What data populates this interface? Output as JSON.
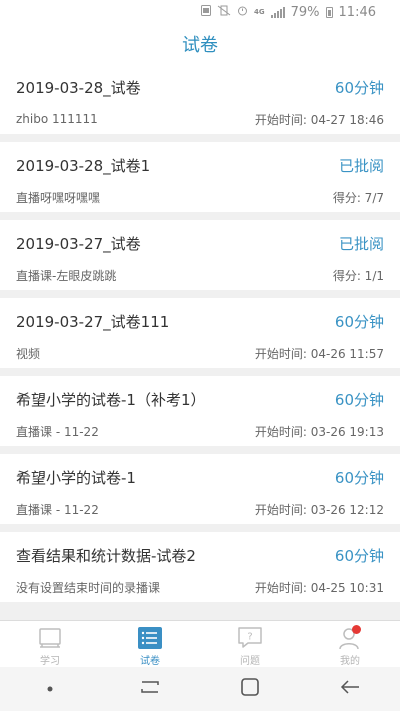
{
  "status_bar": {
    "network": "4G",
    "battery": "79%",
    "time": "11:46"
  },
  "header": {
    "title": "试卷"
  },
  "exams": [
    {
      "name": "2019-03-28_试卷",
      "status": "60分钟",
      "subtitle": "zhibo 111111",
      "meta": "开始时间: 04-27 18:46"
    },
    {
      "name": "2019-03-28_试卷1",
      "status": "已批阅",
      "subtitle": "直播呀嘿呀嘿嘿",
      "meta": "得分: 7/7"
    },
    {
      "name": "2019-03-27_试卷",
      "status": "已批阅",
      "subtitle": "直播课-左眼皮跳跳",
      "meta": "得分: 1/1"
    },
    {
      "name": "2019-03-27_试卷111",
      "status": "60分钟",
      "subtitle": "视频",
      "meta": "开始时间: 04-26 11:57"
    },
    {
      "name": "希望小学的试卷-1（补考1）",
      "status": "60分钟",
      "subtitle": "直播课 - 11-22",
      "meta": "开始时间: 03-26 19:13"
    },
    {
      "name": "希望小学的试卷-1",
      "status": "60分钟",
      "subtitle": "直播课 - 11-22",
      "meta": "开始时间: 03-26 12:12"
    },
    {
      "name": "查看结果和统计数据-试卷2",
      "status": "60分钟",
      "subtitle": "没有设置结束时间的录播课",
      "meta": "开始时间: 04-25 10:31"
    }
  ],
  "bottom_nav": {
    "items": [
      {
        "label": "学习",
        "icon": "book-icon"
      },
      {
        "label": "试卷",
        "icon": "exam-list-icon",
        "active": true
      },
      {
        "label": "问题",
        "icon": "question-bubble-icon"
      },
      {
        "label": "我的",
        "icon": "profile-icon"
      }
    ]
  },
  "colors": {
    "accent": "#3a93c4",
    "title": "#2f8fbf",
    "badge": "#e53935"
  }
}
